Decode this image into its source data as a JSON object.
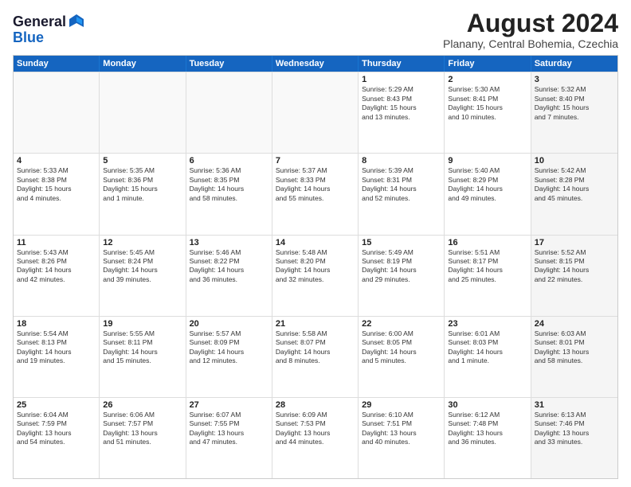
{
  "header": {
    "logo_general": "General",
    "logo_blue": "Blue",
    "month_year": "August 2024",
    "location": "Planany, Central Bohemia, Czechia"
  },
  "weekdays": [
    "Sunday",
    "Monday",
    "Tuesday",
    "Wednesday",
    "Thursday",
    "Friday",
    "Saturday"
  ],
  "rows": [
    [
      {
        "day": "",
        "sunrise": "",
        "sunset": "",
        "daylight": "",
        "empty": true
      },
      {
        "day": "",
        "sunrise": "",
        "sunset": "",
        "daylight": "",
        "empty": true
      },
      {
        "day": "",
        "sunrise": "",
        "sunset": "",
        "daylight": "",
        "empty": true
      },
      {
        "day": "",
        "sunrise": "",
        "sunset": "",
        "daylight": "",
        "empty": true
      },
      {
        "day": "1",
        "sunrise": "Sunrise: 5:29 AM",
        "sunset": "Sunset: 8:43 PM",
        "daylight": "Daylight: 15 hours and 13 minutes."
      },
      {
        "day": "2",
        "sunrise": "Sunrise: 5:30 AM",
        "sunset": "Sunset: 8:41 PM",
        "daylight": "Daylight: 15 hours and 10 minutes."
      },
      {
        "day": "3",
        "sunrise": "Sunrise: 5:32 AM",
        "sunset": "Sunset: 8:40 PM",
        "daylight": "Daylight: 15 hours and 7 minutes.",
        "shaded": true
      }
    ],
    [
      {
        "day": "4",
        "sunrise": "Sunrise: 5:33 AM",
        "sunset": "Sunset: 8:38 PM",
        "daylight": "Daylight: 15 hours and 4 minutes."
      },
      {
        "day": "5",
        "sunrise": "Sunrise: 5:35 AM",
        "sunset": "Sunset: 8:36 PM",
        "daylight": "Daylight: 15 hours and 1 minute."
      },
      {
        "day": "6",
        "sunrise": "Sunrise: 5:36 AM",
        "sunset": "Sunset: 8:35 PM",
        "daylight": "Daylight: 14 hours and 58 minutes."
      },
      {
        "day": "7",
        "sunrise": "Sunrise: 5:37 AM",
        "sunset": "Sunset: 8:33 PM",
        "daylight": "Daylight: 14 hours and 55 minutes."
      },
      {
        "day": "8",
        "sunrise": "Sunrise: 5:39 AM",
        "sunset": "Sunset: 8:31 PM",
        "daylight": "Daylight: 14 hours and 52 minutes."
      },
      {
        "day": "9",
        "sunrise": "Sunrise: 5:40 AM",
        "sunset": "Sunset: 8:29 PM",
        "daylight": "Daylight: 14 hours and 49 minutes."
      },
      {
        "day": "10",
        "sunrise": "Sunrise: 5:42 AM",
        "sunset": "Sunset: 8:28 PM",
        "daylight": "Daylight: 14 hours and 45 minutes.",
        "shaded": true
      }
    ],
    [
      {
        "day": "11",
        "sunrise": "Sunrise: 5:43 AM",
        "sunset": "Sunset: 8:26 PM",
        "daylight": "Daylight: 14 hours and 42 minutes."
      },
      {
        "day": "12",
        "sunrise": "Sunrise: 5:45 AM",
        "sunset": "Sunset: 8:24 PM",
        "daylight": "Daylight: 14 hours and 39 minutes."
      },
      {
        "day": "13",
        "sunrise": "Sunrise: 5:46 AM",
        "sunset": "Sunset: 8:22 PM",
        "daylight": "Daylight: 14 hours and 36 minutes."
      },
      {
        "day": "14",
        "sunrise": "Sunrise: 5:48 AM",
        "sunset": "Sunset: 8:20 PM",
        "daylight": "Daylight: 14 hours and 32 minutes."
      },
      {
        "day": "15",
        "sunrise": "Sunrise: 5:49 AM",
        "sunset": "Sunset: 8:19 PM",
        "daylight": "Daylight: 14 hours and 29 minutes."
      },
      {
        "day": "16",
        "sunrise": "Sunrise: 5:51 AM",
        "sunset": "Sunset: 8:17 PM",
        "daylight": "Daylight: 14 hours and 25 minutes."
      },
      {
        "day": "17",
        "sunrise": "Sunrise: 5:52 AM",
        "sunset": "Sunset: 8:15 PM",
        "daylight": "Daylight: 14 hours and 22 minutes.",
        "shaded": true
      }
    ],
    [
      {
        "day": "18",
        "sunrise": "Sunrise: 5:54 AM",
        "sunset": "Sunset: 8:13 PM",
        "daylight": "Daylight: 14 hours and 19 minutes."
      },
      {
        "day": "19",
        "sunrise": "Sunrise: 5:55 AM",
        "sunset": "Sunset: 8:11 PM",
        "daylight": "Daylight: 14 hours and 15 minutes."
      },
      {
        "day": "20",
        "sunrise": "Sunrise: 5:57 AM",
        "sunset": "Sunset: 8:09 PM",
        "daylight": "Daylight: 14 hours and 12 minutes."
      },
      {
        "day": "21",
        "sunrise": "Sunrise: 5:58 AM",
        "sunset": "Sunset: 8:07 PM",
        "daylight": "Daylight: 14 hours and 8 minutes."
      },
      {
        "day": "22",
        "sunrise": "Sunrise: 6:00 AM",
        "sunset": "Sunset: 8:05 PM",
        "daylight": "Daylight: 14 hours and 5 minutes."
      },
      {
        "day": "23",
        "sunrise": "Sunrise: 6:01 AM",
        "sunset": "Sunset: 8:03 PM",
        "daylight": "Daylight: 14 hours and 1 minute."
      },
      {
        "day": "24",
        "sunrise": "Sunrise: 6:03 AM",
        "sunset": "Sunset: 8:01 PM",
        "daylight": "Daylight: 13 hours and 58 minutes.",
        "shaded": true
      }
    ],
    [
      {
        "day": "25",
        "sunrise": "Sunrise: 6:04 AM",
        "sunset": "Sunset: 7:59 PM",
        "daylight": "Daylight: 13 hours and 54 minutes."
      },
      {
        "day": "26",
        "sunrise": "Sunrise: 6:06 AM",
        "sunset": "Sunset: 7:57 PM",
        "daylight": "Daylight: 13 hours and 51 minutes."
      },
      {
        "day": "27",
        "sunrise": "Sunrise: 6:07 AM",
        "sunset": "Sunset: 7:55 PM",
        "daylight": "Daylight: 13 hours and 47 minutes."
      },
      {
        "day": "28",
        "sunrise": "Sunrise: 6:09 AM",
        "sunset": "Sunset: 7:53 PM",
        "daylight": "Daylight: 13 hours and 44 minutes."
      },
      {
        "day": "29",
        "sunrise": "Sunrise: 6:10 AM",
        "sunset": "Sunset: 7:51 PM",
        "daylight": "Daylight: 13 hours and 40 minutes."
      },
      {
        "day": "30",
        "sunrise": "Sunrise: 6:12 AM",
        "sunset": "Sunset: 7:48 PM",
        "daylight": "Daylight: 13 hours and 36 minutes."
      },
      {
        "day": "31",
        "sunrise": "Sunrise: 6:13 AM",
        "sunset": "Sunset: 7:46 PM",
        "daylight": "Daylight: 13 hours and 33 minutes.",
        "shaded": true
      }
    ]
  ]
}
